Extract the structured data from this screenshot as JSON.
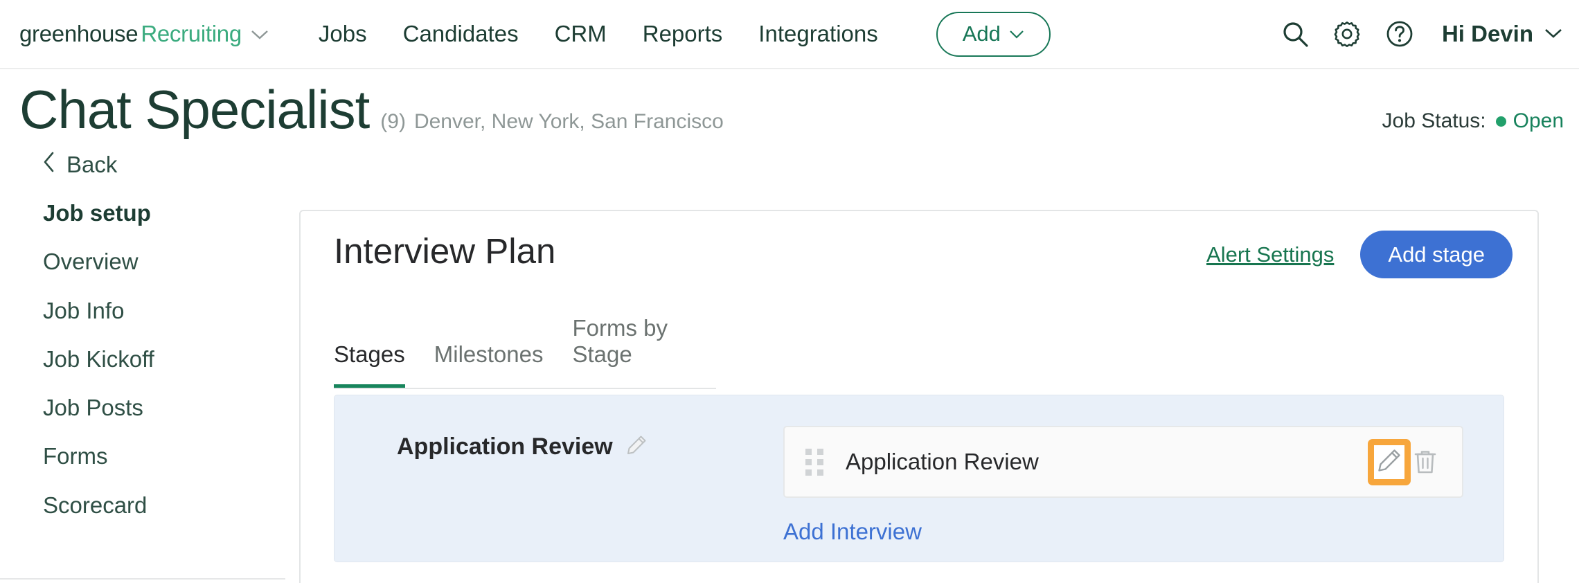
{
  "topnav": {
    "brand": {
      "primary": "greenhouse",
      "secondary": "Recruiting",
      "caret": "chevron-down-icon"
    },
    "links": [
      {
        "label": "Jobs"
      },
      {
        "label": "Candidates"
      },
      {
        "label": "CRM"
      },
      {
        "label": "Reports"
      },
      {
        "label": "Integrations"
      }
    ],
    "add_button": {
      "label": "Add",
      "caret": "∨"
    },
    "icons": [
      {
        "name": "search-icon"
      },
      {
        "name": "gear-icon"
      },
      {
        "name": "help-circle-icon"
      }
    ],
    "greeting": {
      "label": "Hi Devin",
      "caret": "∨"
    }
  },
  "page_header": {
    "job_title": "Chat Specialist",
    "job_count": "(9)",
    "locations": "Denver, New York, San Francisco",
    "status_label": "Job Status:",
    "status_value": "Open",
    "status_color": "#22a06b"
  },
  "sidebar": {
    "back_label": "Back",
    "items": [
      {
        "label": "Job setup",
        "active": true
      },
      {
        "label": "Overview",
        "active": false
      },
      {
        "label": "Job Info",
        "active": false
      },
      {
        "label": "Job Kickoff",
        "active": false
      },
      {
        "label": "Job Posts",
        "active": false
      },
      {
        "label": "Forms",
        "active": false
      },
      {
        "label": "Scorecard",
        "active": false
      }
    ]
  },
  "main": {
    "title": "Interview Plan",
    "alert_settings_label": "Alert Settings",
    "add_stage_label": "Add stage",
    "tabs": [
      {
        "label": "Stages",
        "active": true
      },
      {
        "label": "Milestones",
        "active": false
      },
      {
        "label": "Forms by Stage",
        "active": false
      }
    ],
    "stage": {
      "name": "Application Review",
      "edit_icon": "pencil-icon",
      "interviews": [
        {
          "name": "Application Review",
          "drag_handle": "drag-handle-icon",
          "edit_icon": "pencil-icon",
          "delete_icon": "trash-icon",
          "edit_highlighted": true
        }
      ],
      "add_interview_label": "Add Interview"
    }
  },
  "colors": {
    "brand_green": "#1d3d33",
    "accent_green": "#17855c",
    "link_blue": "#3d71d3",
    "highlight_orange": "#f7a63c",
    "panel_blue": "#e9f0f9"
  }
}
